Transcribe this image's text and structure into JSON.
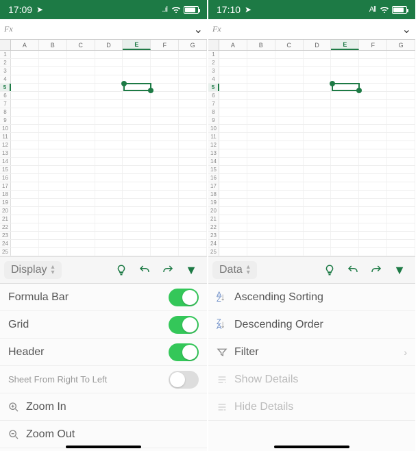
{
  "left": {
    "status": {
      "time": "17:09",
      "signal": "..ıl"
    },
    "fx_label": "Fx",
    "columns": [
      "A",
      "B",
      "C",
      "D",
      "E",
      "F",
      "G"
    ],
    "rows": [
      "1",
      "2",
      "3",
      "4",
      "5",
      "6",
      "7",
      "8",
      "9",
      "10",
      "11",
      "12",
      "13",
      "14",
      "15",
      "16",
      "17",
      "18",
      "19",
      "20",
      "21",
      "22",
      "23",
      "24",
      "25"
    ],
    "selected_col": "E",
    "selected_row": "5",
    "toolbar": {
      "mode": "Display"
    },
    "options": {
      "formula_bar": "Formula Bar",
      "grid": "Grid",
      "header": "Header",
      "sheet_rtl": "Sheet From Right To Left",
      "zoom_in": "Zoom In",
      "zoom_out": "Zoom Out"
    },
    "toggles": {
      "formula_bar": true,
      "grid": true,
      "header": true,
      "sheet_rtl": false
    }
  },
  "right": {
    "status": {
      "time": "17:10",
      "signal": "All"
    },
    "fx_label": "Fx",
    "columns": [
      "A",
      "B",
      "C",
      "D",
      "E",
      "F",
      "G"
    ],
    "rows": [
      "1",
      "2",
      "3",
      "4",
      "5",
      "6",
      "7",
      "8",
      "9",
      "10",
      "11",
      "12",
      "13",
      "14",
      "15",
      "16",
      "17",
      "18",
      "19",
      "20",
      "21",
      "22",
      "23",
      "24",
      "25"
    ],
    "selected_col": "E",
    "selected_row": "5",
    "toolbar": {
      "mode": "Data"
    },
    "options": {
      "asc": "Ascending Sorting",
      "desc": "Descending Order",
      "filter": "Filter",
      "show": "Show Details",
      "hide": "Hide Details"
    }
  },
  "colors": {
    "accent": "#1d7a45",
    "toggle_on": "#34c759"
  }
}
